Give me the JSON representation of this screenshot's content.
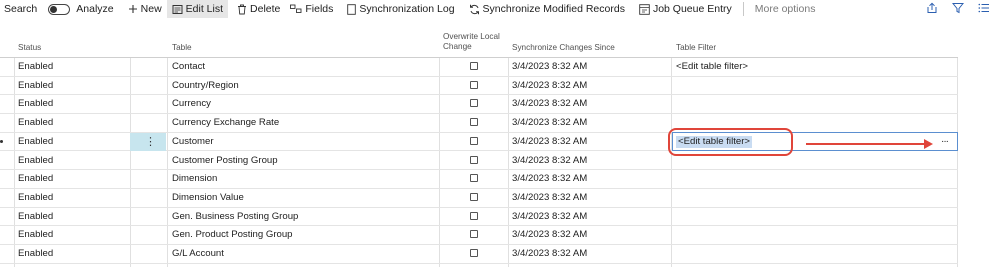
{
  "toolbar": {
    "search_label": "Search",
    "analyze_label": "Analyze",
    "new_label": "New",
    "edit_list_label": "Edit List",
    "delete_label": "Delete",
    "fields_label": "Fields",
    "sync_log_label": "Synchronization Log",
    "sync_modified_label": "Synchronize Modified Records",
    "job_queue_label": "Job Queue Entry",
    "more_options_label": "More options"
  },
  "table": {
    "headers": {
      "status": "Status",
      "table": "Table",
      "overwrite_line1": "Overwrite Local",
      "overwrite_line2": "Change",
      "sync_since": "Synchronize Changes Since",
      "filter": "Table Filter"
    },
    "rows": [
      {
        "status": "Enabled",
        "table": "Contact",
        "sync": "3/4/2023 8:32 AM",
        "filter": "<Edit table filter>"
      },
      {
        "status": "Enabled",
        "table": "Country/Region",
        "sync": "3/4/2023 8:32 AM",
        "filter": ""
      },
      {
        "status": "Enabled",
        "table": "Currency",
        "sync": "3/4/2023 8:32 AM",
        "filter": ""
      },
      {
        "status": "Enabled",
        "table": "Currency Exchange Rate",
        "sync": "3/4/2023 8:32 AM",
        "filter": ""
      },
      {
        "status": "Enabled",
        "table": "Customer",
        "sync": "3/4/2023 8:32 AM",
        "filter": "<Edit table filter>"
      },
      {
        "status": "Enabled",
        "table": "Customer Posting Group",
        "sync": "3/4/2023 8:32 AM",
        "filter": ""
      },
      {
        "status": "Enabled",
        "table": "Dimension",
        "sync": "3/4/2023 8:32 AM",
        "filter": ""
      },
      {
        "status": "Enabled",
        "table": "Dimension Value",
        "sync": "3/4/2023 8:32 AM",
        "filter": ""
      },
      {
        "status": "Enabled",
        "table": "Gen. Business Posting Group",
        "sync": "3/4/2023 8:32 AM",
        "filter": ""
      },
      {
        "status": "Enabled",
        "table": "Gen. Product Posting Group",
        "sync": "3/4/2023 8:32 AM",
        "filter": ""
      },
      {
        "status": "Enabled",
        "table": "G/L Account",
        "sync": "3/4/2023 8:32 AM",
        "filter": ""
      }
    ],
    "selected_row_index": 4,
    "row_menu_glyph": "⋮",
    "assist_button_glyph": "···"
  },
  "icons": {
    "new": "plus-icon",
    "edit_list": "edit-list-icon",
    "delete": "trash-icon",
    "fields": "fields-icon",
    "sync_log": "document-icon",
    "sync_modified": "sync-icon",
    "job_queue": "job-queue-icon",
    "share": "share-icon",
    "filter": "filter-icon",
    "list": "list-icon"
  },
  "colors": {
    "selected_cell": "#c7e5ee",
    "callout": "#e0453a",
    "input_border": "#5b8fd0"
  }
}
